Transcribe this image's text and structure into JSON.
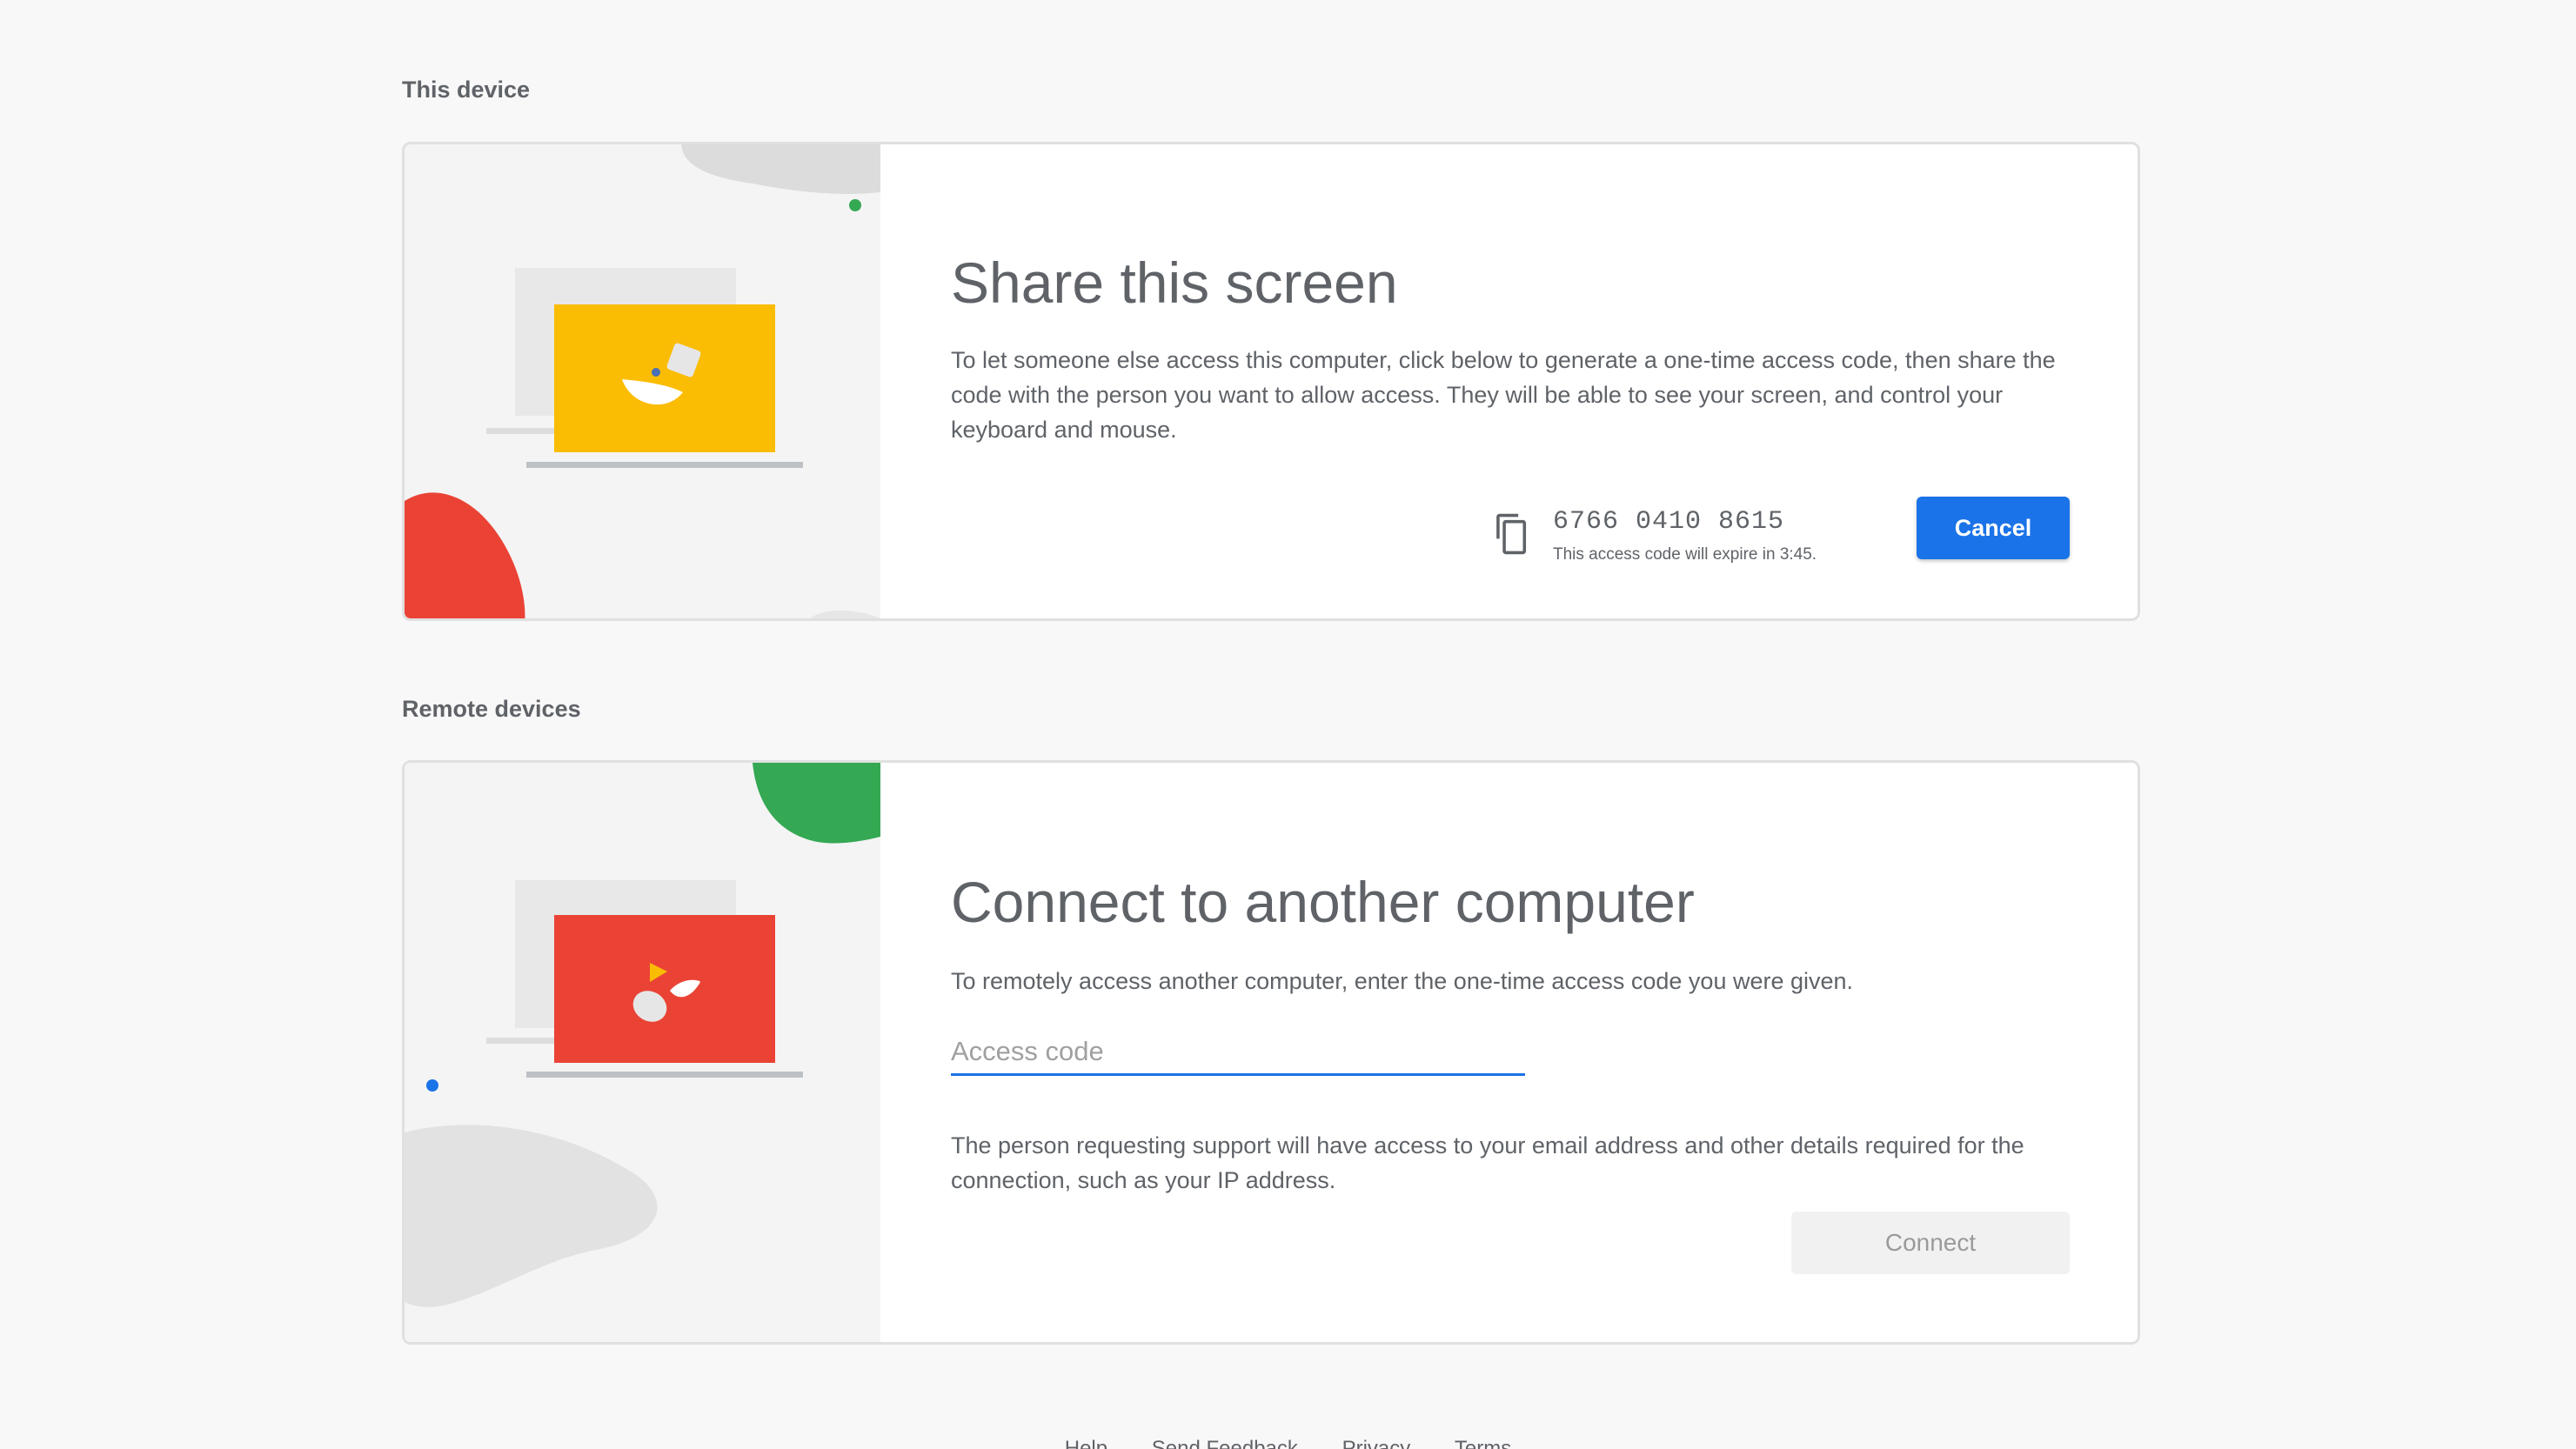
{
  "this_device": {
    "section_label": "This device",
    "card": {
      "title": "Share this screen",
      "description": "To let someone else access this computer, click below to generate a one-time access code, then share the code with the person you want to allow access. They will be able to see your screen, and control your keyboard and mouse.",
      "access_code": "6766 0410 8615",
      "expire_text": "This access code will expire in 3:45.",
      "cancel_label": "Cancel",
      "copy_icon": "copy-icon"
    }
  },
  "remote_devices": {
    "section_label": "Remote devices",
    "card": {
      "title": "Connect to another computer",
      "description": "To remotely access another computer, enter the one-time access code you were given.",
      "input_placeholder": "Access code",
      "input_value": "",
      "support_notice": "The person requesting support will have access to your email address and other details required for the connection, such as your IP address.",
      "connect_label": "Connect"
    }
  },
  "footer": {
    "links": [
      "Help",
      "Send Feedback",
      "Privacy",
      "Terms"
    ]
  },
  "colors": {
    "primary_blue": "#1a73e8",
    "yellow": "#fbbc04",
    "red": "#ea4335",
    "green": "#34a853",
    "text_gray": "#5f6368"
  }
}
